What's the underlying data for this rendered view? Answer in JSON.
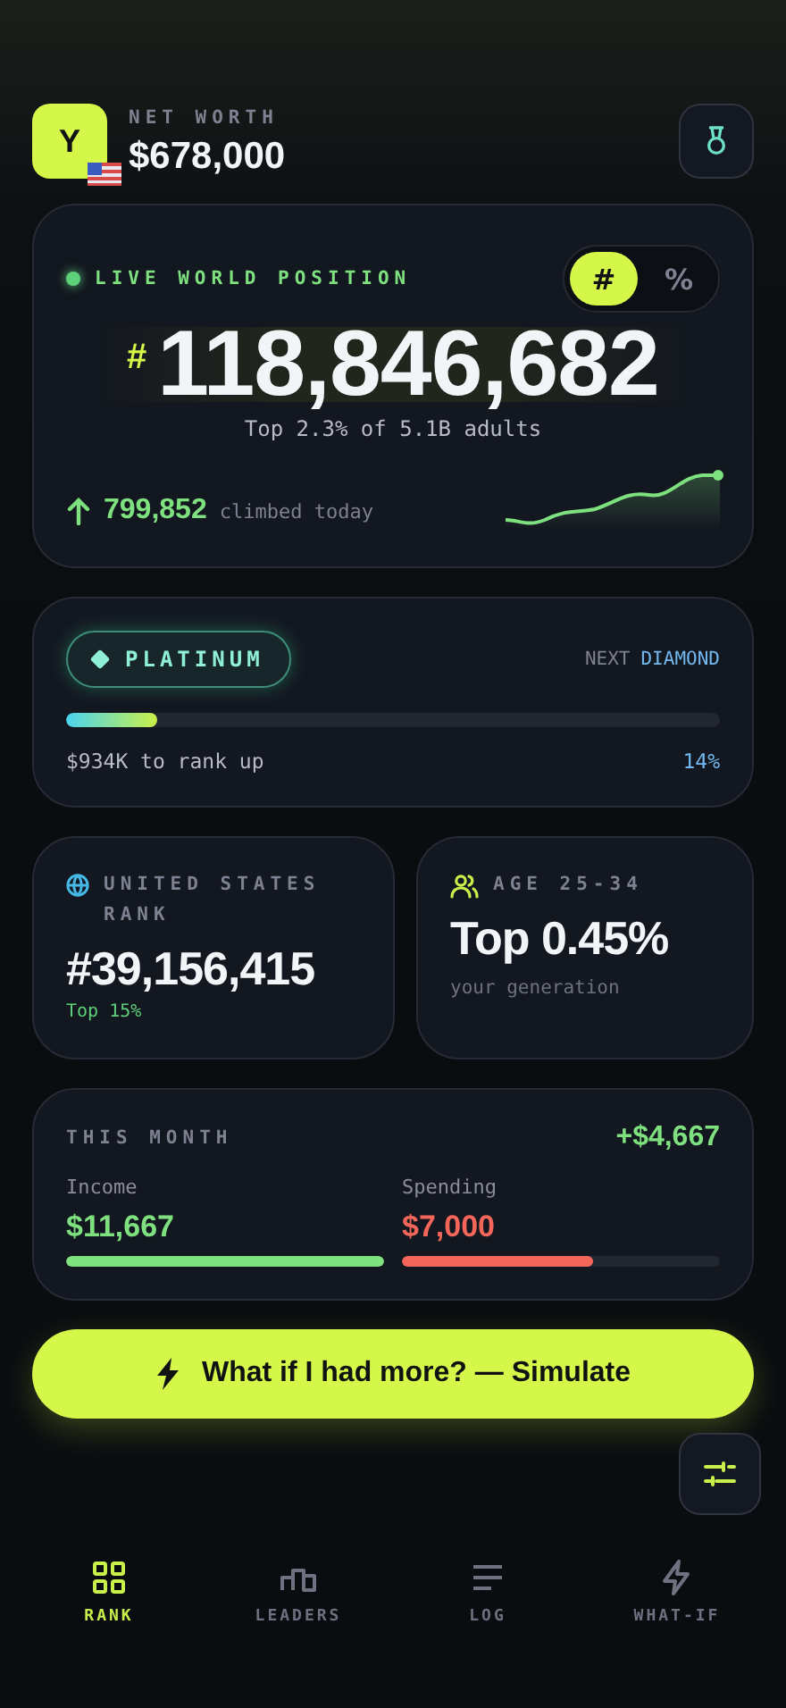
{
  "header": {
    "avatar": "Y",
    "label": "NET WORTH",
    "value": "$678,000"
  },
  "position": {
    "label": "LIVE WORLD POSITION",
    "live": true,
    "toggle": [
      {
        "label": "#",
        "selected": true
      },
      {
        "label": "%",
        "selected": false
      }
    ],
    "prefix": "#",
    "rank": "118,846,682",
    "subtitle": "Top 2.3% of 5.1B adults",
    "climbed": "799,852",
    "climbed_label": "climbed today"
  },
  "tier": {
    "name": "PLATINUM",
    "next_label": "NEXT",
    "next": "DIAMOND",
    "level": 0.14,
    "remaining": "$934K to rank up",
    "percent": "14%"
  },
  "country": {
    "label": "UNITED STATES RANK",
    "value": "#39,156,415",
    "sub": "Top 15%"
  },
  "age": {
    "label": "AGE 25-34",
    "value": "Top 0.45%",
    "sub": "your generation"
  },
  "month": {
    "label": "THIS MONTH",
    "net": "+$4,667",
    "bars": [
      {
        "label": "Income",
        "value": "$11,667",
        "color": "#7ee07f",
        "level": 1.0
      },
      {
        "label": "Spending",
        "value": "$7,000",
        "color": "#f4665a",
        "level": 0.6
      }
    ]
  },
  "cta": "What if I had more? — Simulate",
  "nav": [
    {
      "label": "RANK",
      "kind": "grid",
      "selected": true
    },
    {
      "label": "LEADERS",
      "kind": "podium",
      "selected": false
    },
    {
      "label": "LOG",
      "kind": "lines",
      "selected": false
    },
    {
      "label": "WHAT-IF",
      "kind": "bolt",
      "selected": false
    }
  ]
}
